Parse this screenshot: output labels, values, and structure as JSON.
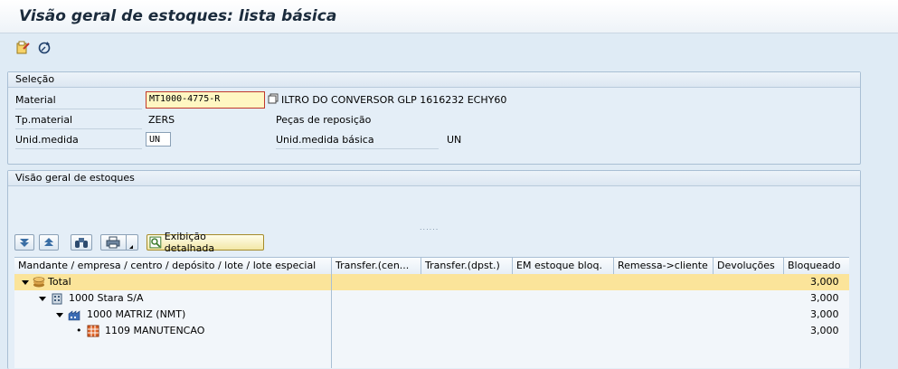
{
  "window": {
    "title": "Visão geral de estoques: lista básica"
  },
  "toolbar": {
    "icons": [
      "display-change-icon",
      "refresh-icon"
    ]
  },
  "selection": {
    "header": "Seleção",
    "material_label": "Material",
    "material_value": "MT1000-4775-R",
    "material_description": "ILTRO DO CONVERSOR GLP 1616232 ECHY60",
    "material_type_label": "Tp.material",
    "material_type_value": "ZERS",
    "material_type_description": "Peças de reposição",
    "unit_label": "Unid.medida",
    "unit_value": "UN",
    "base_unit_label": "Unid.medida básica",
    "base_unit_value": "UN"
  },
  "stock_overview": {
    "header": "Visão geral de estoques",
    "splitter": "......",
    "detail_button_label": "Exibição detalhada",
    "columns": [
      "Mandante / empresa / centro / depósito / lote / lote especial",
      "Transfer.(cen...",
      "Transfer.(dpst.)",
      "EM estoque bloq.",
      "Remessa->cliente",
      "Devoluções",
      "Bloqueado"
    ],
    "rows": [
      {
        "label": "Total",
        "blocked": "3,000"
      },
      {
        "label": "1000 Stara S/A",
        "blocked": "3,000"
      },
      {
        "label": "1000 MATRIZ (NMT)",
        "blocked": "3,000"
      },
      {
        "label": "1109 MANUTENCAO",
        "blocked": "3,000"
      }
    ]
  },
  "colors": {
    "highlight_row": "#fbe49a",
    "background": "#dfebf5",
    "focus_border": "#c0392b"
  }
}
